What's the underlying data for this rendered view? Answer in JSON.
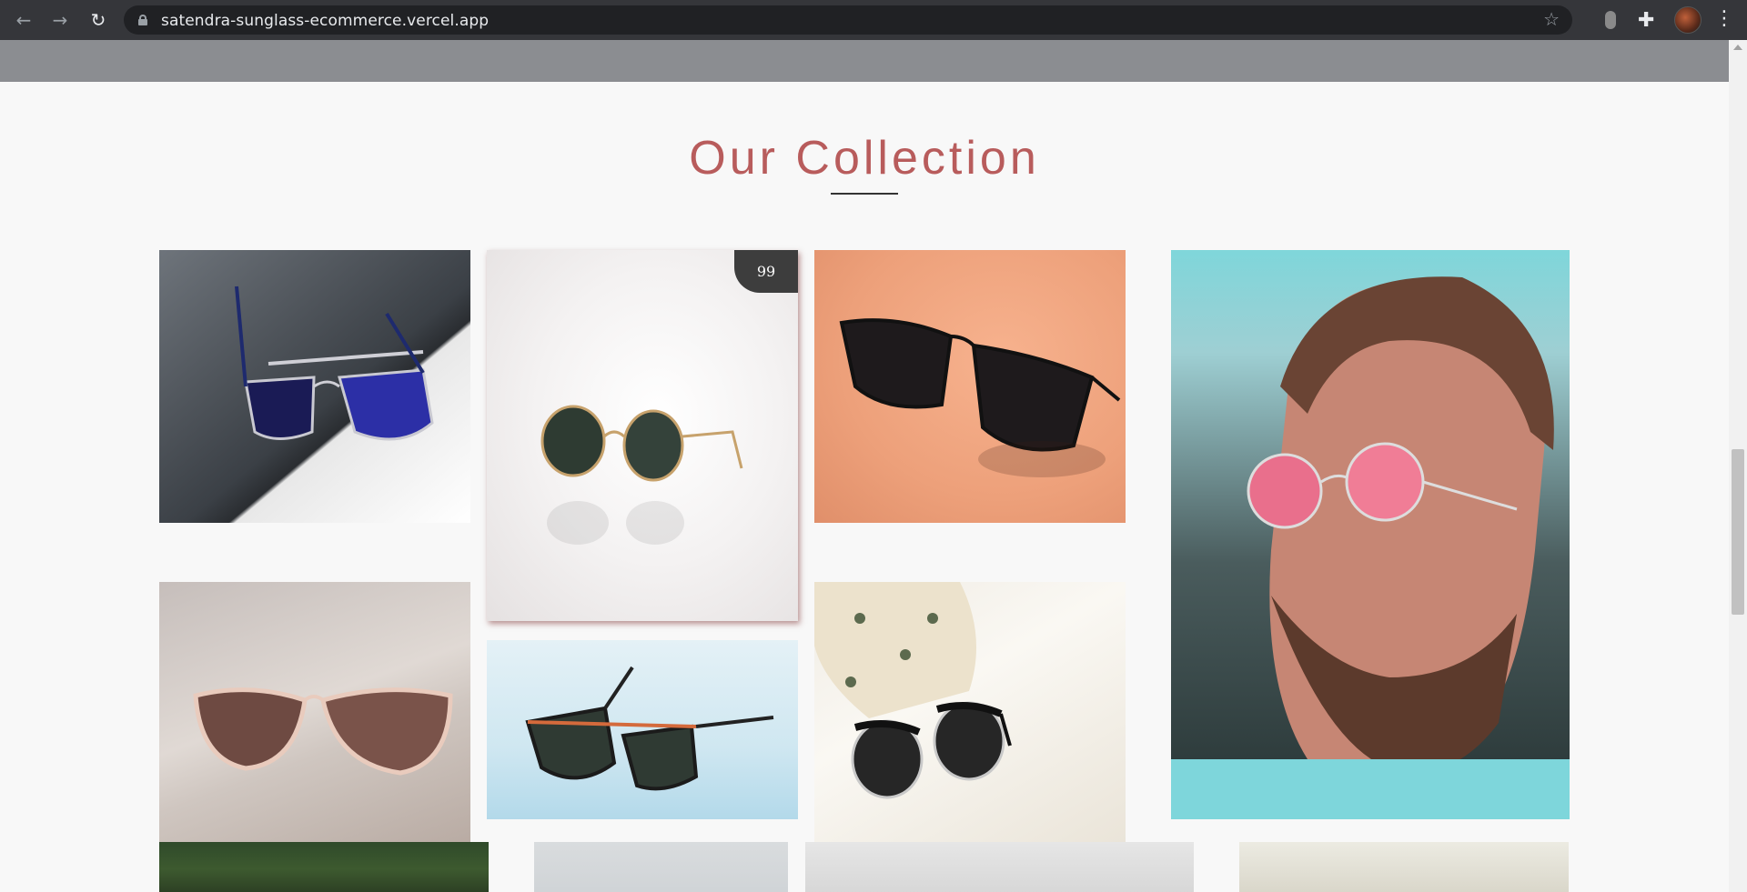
{
  "browser": {
    "url": "satendra-sunglass-ecommerce.vercel.app",
    "icons": {
      "back": "back-arrow-icon",
      "forward": "forward-arrow-icon",
      "reload": "reload-icon",
      "lock": "lock-icon",
      "bookmark": "star-icon",
      "extension": "extension-puzzle-icon",
      "profile": "profile-avatar",
      "menu": "kebab-menu-icon"
    },
    "glyphs": {
      "back": "←",
      "forward": "→",
      "reload": "↻",
      "star": "☆",
      "puzzle": "✚",
      "menu": "⋮"
    }
  },
  "collection": {
    "title": "Our Collection",
    "title_color": "#b85c5c",
    "badge_value": "99",
    "products": [
      {
        "name": "aviator-blue-lens"
      },
      {
        "name": "round-gold-green-lens"
      },
      {
        "name": "black-wayfarer-orange-bg"
      },
      {
        "name": "model-pink-round-lens"
      },
      {
        "name": "cat-eye-rose-gold"
      },
      {
        "name": "black-orange-rectangular"
      },
      {
        "name": "clubmaster-pineapple-case"
      },
      {
        "name": "row3-photo-1"
      },
      {
        "name": "row3-photo-2"
      },
      {
        "name": "row3-photo-3"
      },
      {
        "name": "row3-photo-4"
      }
    ]
  },
  "colors": {
    "page_bg": "#f8f8f8",
    "topbar": "#8b8d91",
    "badge_bg": "#3d3d3d"
  }
}
